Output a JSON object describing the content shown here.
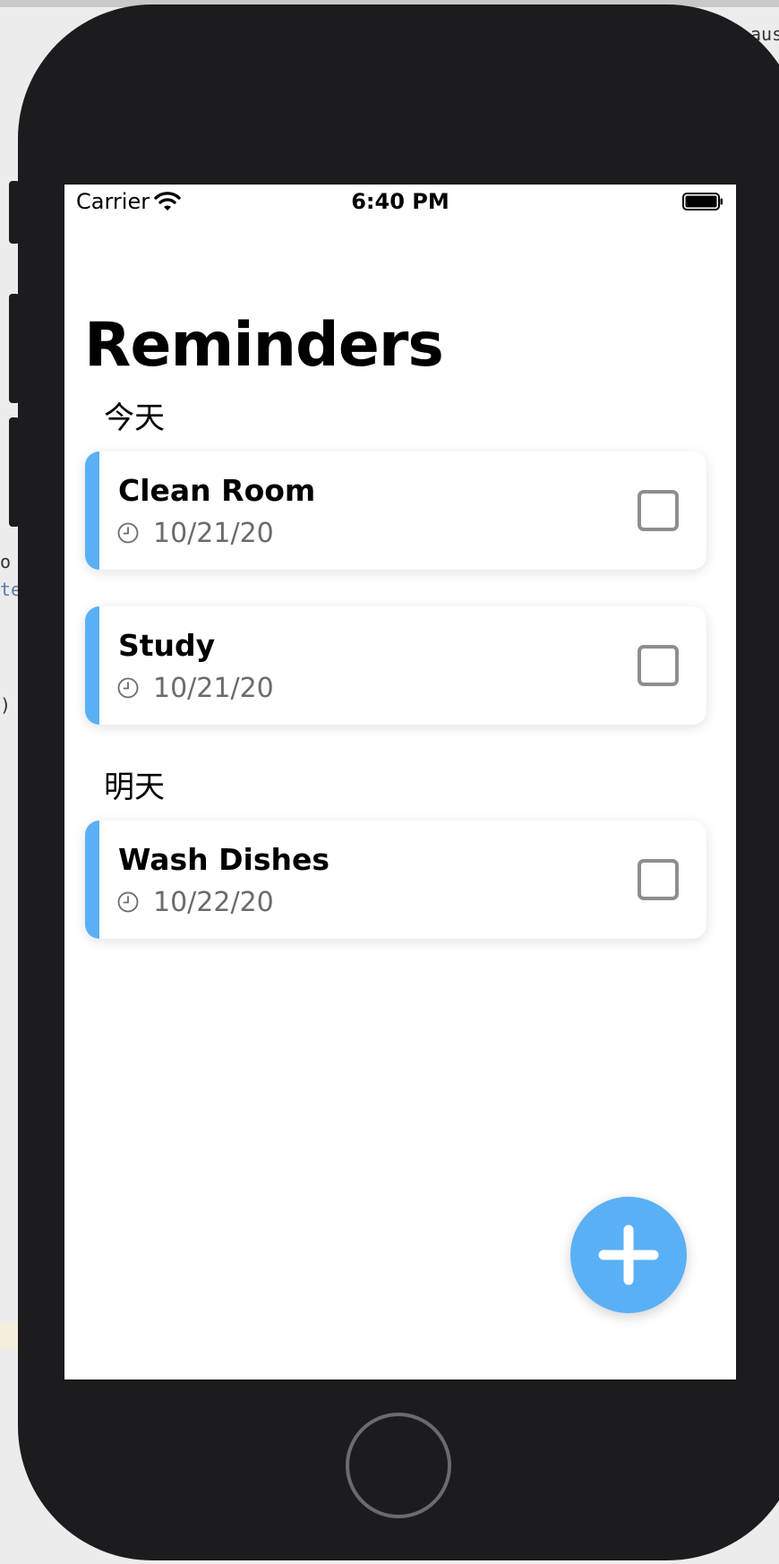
{
  "status_bar": {
    "carrier": "Carrier",
    "time": "6:40 PM"
  },
  "page": {
    "title": "Reminders"
  },
  "sections": [
    {
      "header": "今天",
      "items": [
        {
          "title": "Clean Room",
          "date": "10/21/20",
          "done": false
        },
        {
          "title": "Study",
          "date": "10/21/20",
          "done": false
        }
      ]
    },
    {
      "header": "明天",
      "items": [
        {
          "title": "Wash Dishes",
          "date": "10/22/20",
          "done": false
        }
      ]
    }
  ],
  "background_code": {
    "top_right_fragment": "aus",
    "line1": "o",
    "line2": "te",
    "line3": ")"
  },
  "icons": {
    "wifi": "wifi-icon",
    "battery": "battery-icon",
    "clock": "clock-icon",
    "add": "plus-icon"
  },
  "colors": {
    "accent": "#5ab0f5",
    "device": "#1c1c1e",
    "checkbox_border": "#8e8e8e",
    "date_text": "#6b6b6b"
  }
}
